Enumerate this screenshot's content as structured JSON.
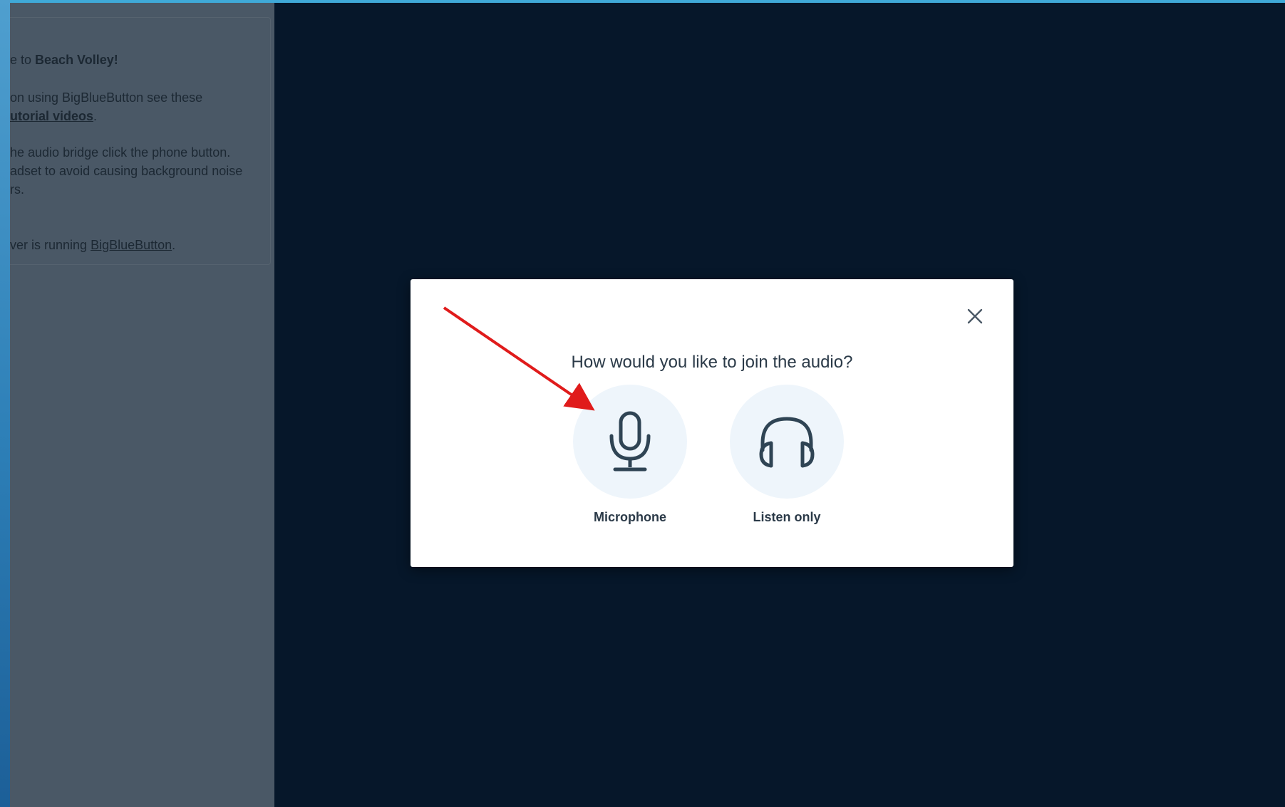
{
  "sidebar": {
    "welcome": {
      "line1_prefix": "e to ",
      "line1_bold": "Beach Volley",
      "line1_suffix": "!",
      "line2a": "on using BigBlueButton see these",
      "line2b_link": "utorial videos",
      "line2b_suffix": ".",
      "line3a": "he audio bridge click the phone button.",
      "line3b": "adset to avoid causing background noise",
      "line3c": "rs.",
      "line4_prefix": "ver is running ",
      "line4_link": "BigBlueButton",
      "line4_suffix": "."
    }
  },
  "audio_modal": {
    "title": "How would you like to join the audio?",
    "close_icon": "close-icon",
    "options": [
      {
        "label": "Microphone",
        "icon": "microphone-icon"
      },
      {
        "label": "Listen only",
        "icon": "headphones-icon"
      }
    ]
  },
  "annotation": {
    "arrow_color": "#e01b1b"
  },
  "colors": {
    "background": "#06172a",
    "sidebar": "#4a5866",
    "modal": "#ffffff",
    "option_circle": "#eef5fb",
    "icon": "#2f4454"
  }
}
